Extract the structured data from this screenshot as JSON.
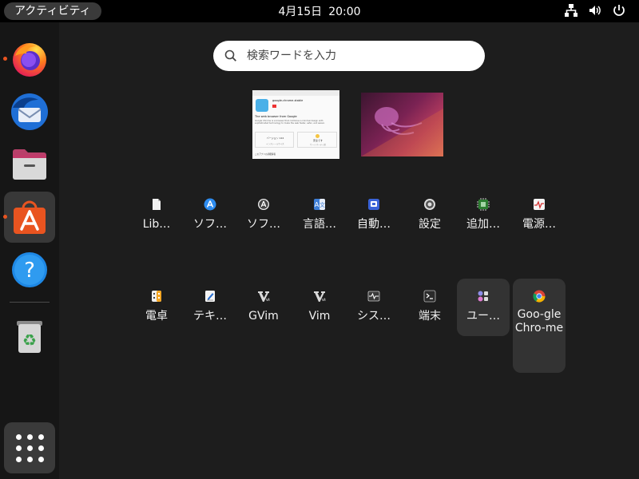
{
  "topbar": {
    "activities": "アクティビティ",
    "date": "4月15日",
    "time": "20:00",
    "tray_icons": [
      "network-icon",
      "volume-icon",
      "power-icon"
    ]
  },
  "dock": {
    "items": [
      {
        "name": "firefox",
        "running": true
      },
      {
        "name": "thunderbird",
        "running": false
      },
      {
        "name": "files",
        "running": false
      },
      {
        "name": "app-center",
        "running": true,
        "active": true
      },
      {
        "name": "help",
        "running": false
      },
      {
        "name": "trash",
        "running": false
      }
    ],
    "show_apps": "show-apps-icon"
  },
  "search": {
    "placeholder": "検索ワードを入力"
  },
  "workspace1": {
    "title": "google-chrome-stable",
    "subtitle": "The web browser from Google",
    "desc": "Google Chrome is a browser that combines a minimal design with sophisticated technology to make the web faster, safer, and easier.",
    "card1_title": "バージョン 124",
    "card1_sub": "インストールサイズ",
    "card2_title": "安全です",
    "card2_sub": "サードパーティ製",
    "footer": "このアプリの詳細情報"
  },
  "apps_row1": [
    {
      "label": "Lib…",
      "icon": "document-icon"
    },
    {
      "label": "ソフ…",
      "icon": "app-store-icon"
    },
    {
      "label": "ソフ…",
      "icon": "software-updater-icon"
    },
    {
      "label": "言語…",
      "icon": "language-icon"
    },
    {
      "label": "自動…",
      "icon": "startup-apps-icon"
    },
    {
      "label": "設定",
      "icon": "settings-icon"
    },
    {
      "label": "追加…",
      "icon": "drivers-icon"
    },
    {
      "label": "電源…",
      "icon": "power-stats-icon"
    }
  ],
  "apps_row2": [
    {
      "label": "電卓",
      "icon": "calculator-icon"
    },
    {
      "label": "テキ…",
      "icon": "text-editor-icon"
    },
    {
      "label": "GVim",
      "icon": "gvim-icon"
    },
    {
      "label": "Vim",
      "icon": "vim-icon"
    },
    {
      "label": "シス…",
      "icon": "system-monitor-icon"
    },
    {
      "label": "端末",
      "icon": "terminal-icon"
    },
    {
      "label": "ユー…",
      "icon": "utilities-icon"
    },
    {
      "label": "Goo-gle Chro-me",
      "icon": "chrome-icon"
    }
  ],
  "colors": {
    "accent": "#e95420",
    "background": "#1d1d1d",
    "dock": "#161616",
    "topbar": "#000000"
  }
}
